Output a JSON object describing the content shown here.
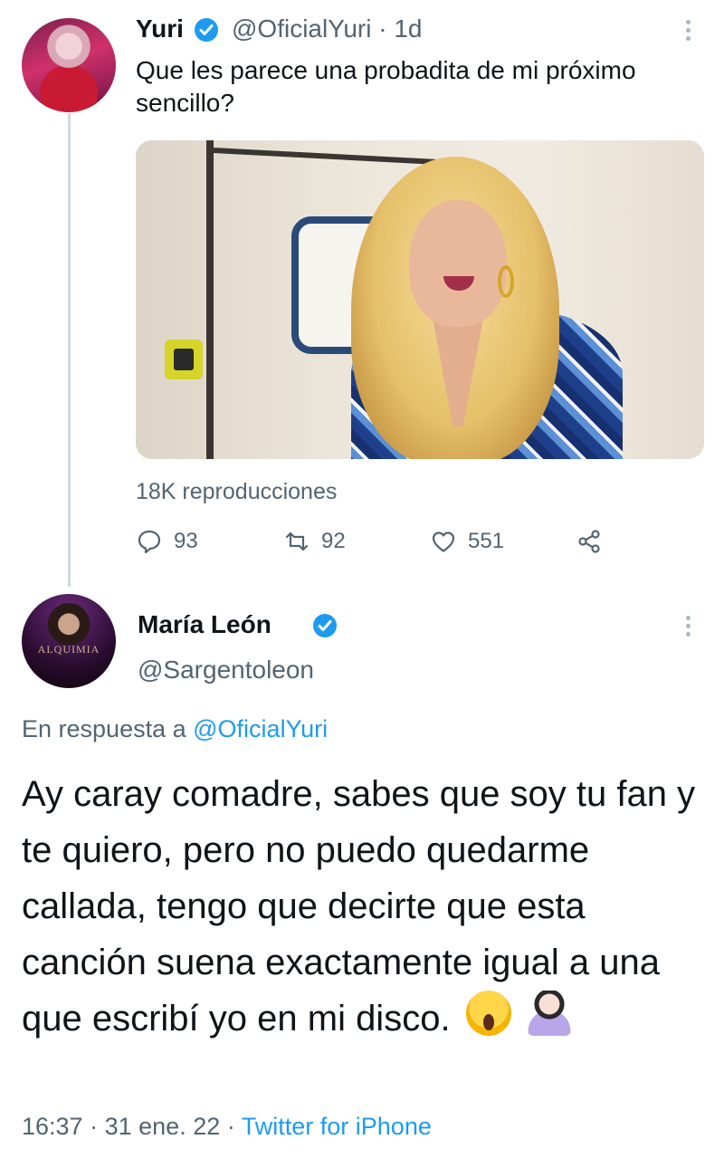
{
  "original_tweet": {
    "author_name": "Yuri",
    "handle": "@OficialYuri",
    "separator": "·",
    "time_ago": "1d",
    "text": "Que les parece una probadita de mi próximo sencillo?",
    "views": "18K reproducciones",
    "actions": {
      "reply_count": "93",
      "retweet_count": "92",
      "like_count": "551"
    }
  },
  "reply_tweet": {
    "author_name": "María León",
    "handle": "@Sargentoleon",
    "avatar_text": "ALQUIMIA",
    "reply_prefix": "En respuesta a",
    "reply_to_handle": "@OficialYuri",
    "text": "Ay caray comadre, sabes que soy tu fan y te quiero, pero no puedo quedarme callada, tengo que decirte que esta canción suena exactamente igual a una que escribí yo en mi disco.",
    "emojis": [
      "face-screaming-in-fear",
      "person-shrugging"
    ],
    "time": "16:37",
    "separator_1": "·",
    "date": "31 ene. 22",
    "separator_2": "·",
    "source": "Twitter for iPhone"
  },
  "colors": {
    "accent": "#1d9bf0",
    "secondary_text": "#536471",
    "primary_text": "#0f1419",
    "thread_line": "#cfd9de"
  }
}
